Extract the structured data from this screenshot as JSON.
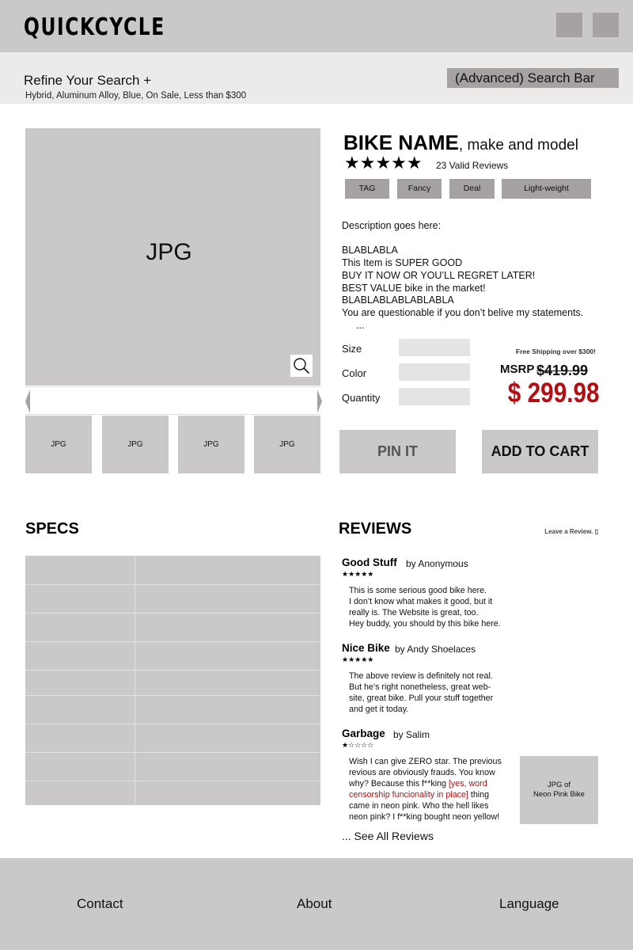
{
  "header": {
    "logo": "QUICKCYCLE"
  },
  "refine": {
    "title": "Refine Your Search +",
    "filters": "Hybrid, Aluminum Alloy, Blue, On Sale, Less than $300",
    "search_label": "(Advanced) Search Bar"
  },
  "gallery": {
    "main_label": "JPG",
    "thumbs": [
      "JPG",
      "JPG",
      "JPG",
      "JPG"
    ]
  },
  "product": {
    "name": "BIKE NAME",
    "subtitle": ", make and model",
    "stars": "★★★★★",
    "reviews_count": "23 Valid Reviews",
    "tags": [
      "TAG",
      "Fancy",
      "Deal",
      "Light-weight"
    ],
    "description": {
      "heading": "Description goes here:",
      "lines": [
        "BLABLABLA",
        "This Item is SUPER GOOD",
        "BUY IT NOW OR YOU’LL REGRET LATER!",
        "BEST VALUE bike in the market!",
        "BLABLABLABLABLABLA",
        "You are questionable if you don’t belive my statements."
      ],
      "ellipsis": "..."
    },
    "options": {
      "size_label": "Size",
      "color_label": "Color",
      "quantity_label": "Quantity"
    },
    "shipping_note": "Free Shipping over $300!",
    "msrp_label": "MSRP",
    "msrp_value": "$419.99",
    "price": "$ 299.98",
    "pin_label": "PIN IT",
    "cart_label": "ADD TO CART"
  },
  "specs": {
    "title": "SPECS"
  },
  "reviews": {
    "title": "REVIEWS",
    "leave_label": "Leave a Review. ▯",
    "items": [
      {
        "title": "Good Stuff",
        "by": "by Anonymous",
        "stars": "★★★★★",
        "lines": [
          "This is some serious good bike here.",
          "I don’t know what makes it good, but it",
          "really is. The Website is great, too.",
          "Hey buddy, you should by this bike here."
        ]
      },
      {
        "title": "Nice Bike",
        "by": "by Andy Shoelaces",
        "stars": "★★★★★",
        "lines": [
          "The above review is definitely not real.",
          "But he’s right nonetheless, great web-",
          "site, great bike. Pull your stuff together",
          "and get it today."
        ]
      },
      {
        "title": "Garbage",
        "by": "by Salim",
        "stars": "★☆☆☆☆",
        "line1": "Wish I can give ZERO star. The previous",
        "line2": "revious are obviously frauds. You know",
        "line3_a": "why? Because this f**king ",
        "line3_red": "[yes, word",
        "line4_red": "censorship funcionality in place]",
        "line4_b": " thing",
        "line5": "came in neon pink. Who the hell likes",
        "line6": "neon pink? I f**king bought neon yellow!",
        "image_line1": "JPG of",
        "image_line2": "Neon Pink Bike"
      }
    ],
    "see_all": "... See All Reviews"
  },
  "footer": {
    "contact": "Contact",
    "about": "About",
    "language": "Language"
  }
}
